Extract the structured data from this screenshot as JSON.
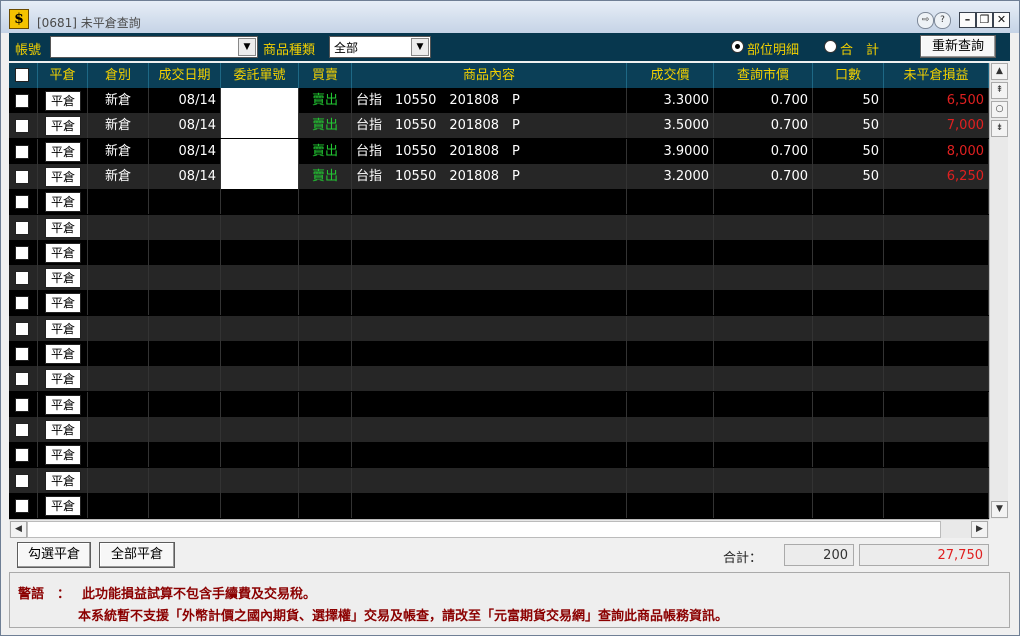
{
  "window": {
    "title": "[0681] 未平倉查詢",
    "icon_glyph": "$"
  },
  "toolbar": {
    "account_label": "帳號",
    "account_value": "",
    "product_type_label": "商品種類",
    "product_type_value": "全部",
    "view_options": [
      {
        "label": "部位明細",
        "selected": true
      },
      {
        "label": "合　計",
        "selected": false
      }
    ],
    "requery_button": "重新查詢"
  },
  "grid": {
    "columns": [
      "",
      "平倉",
      "倉別",
      "成交日期",
      "委託單號",
      "買賣",
      "商品內容",
      "成交價",
      "查詢市價",
      "口數",
      "未平倉損益"
    ],
    "close_button_label": "平倉",
    "rows": [
      {
        "type": "新倉",
        "date": "08/14",
        "order_no": "",
        "side": "賣出",
        "product": "台指　10550　201808　P",
        "price": "3.3000",
        "market": "0.700",
        "qty": "50",
        "pnl": "6,500"
      },
      {
        "type": "新倉",
        "date": "08/14",
        "order_no": "",
        "side": "賣出",
        "product": "台指　10550　201808　P",
        "price": "3.5000",
        "market": "0.700",
        "qty": "50",
        "pnl": "7,000"
      },
      {
        "type": "新倉",
        "date": "08/14",
        "order_no": "",
        "side": "賣出",
        "product": "台指　10550　201808　P",
        "price": "3.9000",
        "market": "0.700",
        "qty": "50",
        "pnl": "8,000"
      },
      {
        "type": "新倉",
        "date": "08/14",
        "order_no": "",
        "side": "賣出",
        "product": "台指　10550　201808　P",
        "price": "3.2000",
        "market": "0.700",
        "qty": "50",
        "pnl": "6,250"
      }
    ],
    "empty_rows": 13
  },
  "footer": {
    "close_selected_button": "勾選平倉",
    "close_all_button": "全部平倉",
    "total_label": "合計：",
    "total_qty": "200",
    "total_pnl": "27,750"
  },
  "warning": {
    "prefix": "警語　：",
    "line1": "此功能損益試算不包含手續費及交易稅。",
    "line2": "本系統暫不支援「外幣計價之國內期貨、選擇權」交易及帳查，請改至「元富期貨交易網」查詢此商品帳務資訊。"
  },
  "colors": {
    "header_bg": "#0b3f57",
    "header_text": "#f2d000",
    "sell": "#22c832",
    "pnl": "#e02020",
    "warning": "#8b0000"
  }
}
